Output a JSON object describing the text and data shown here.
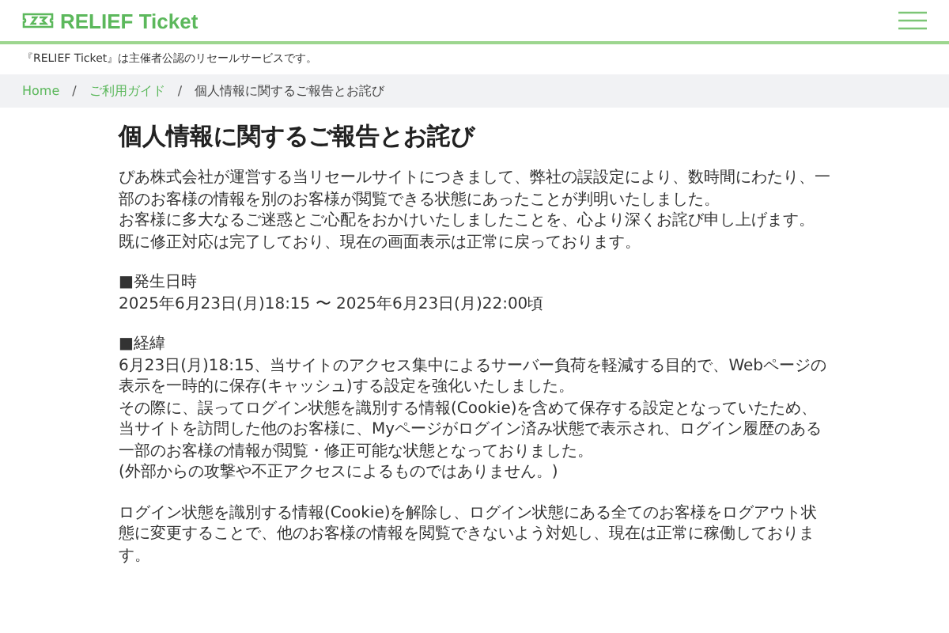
{
  "header": {
    "logo_text": "RELIEF Ticket"
  },
  "notice": "『RELIEF Ticket』は主催者公認のリセールサービスです。",
  "breadcrumb": {
    "separator": "/",
    "items": [
      {
        "label": "Home",
        "current": false
      },
      {
        "label": "ご利用ガイド",
        "current": false
      },
      {
        "label": "個人情報に関するご報告とお詫び",
        "current": true
      }
    ]
  },
  "article": {
    "title": "個人情報に関するご報告とお詫び",
    "blocks": [
      [
        "ぴあ株式会社が運営する当リセールサイトにつきまして、弊社の誤設定により、数時間にわたり、一部のお客様の情報を別のお客様が閲覧できる状態にあったことが判明いたしました。",
        "お客様に多大なるご迷惑とご心配をおかけいたしましたことを、心より深くお詫び申し上げます。",
        "既に修正対応は完了しており、現在の画面表示は正常に戻っております。"
      ],
      [
        "■発生日時",
        "2025年6月23日(月)18:15 〜 2025年6月23日(月)22:00頃"
      ],
      [
        "■経緯",
        "6月23日(月)18:15、当サイトのアクセス集中によるサーバー負荷を軽減する目的で、Webページの表示を一時的に保存(キャッシュ)する設定を強化いたしました。",
        "その際に、誤ってログイン状態を識別する情報(Cookie)を含めて保存する設定となっていたため、当サイトを訪問した他のお客様に、Myページがログイン済み状態で表示され、ログイン履歴のある一部のお客様の情報が閲覧・修正可能な状態となっておりました。",
        "(外部からの攻撃や不正アクセスによるものではありません。)"
      ],
      [
        "ログイン状態を識別する情報(Cookie)を解除し、ログイン状態にある全てのお客様をログアウト状態に変更することで、他のお客様の情報を閲覧できないよう対処し、現在は正常に稼働しております。"
      ]
    ]
  }
}
